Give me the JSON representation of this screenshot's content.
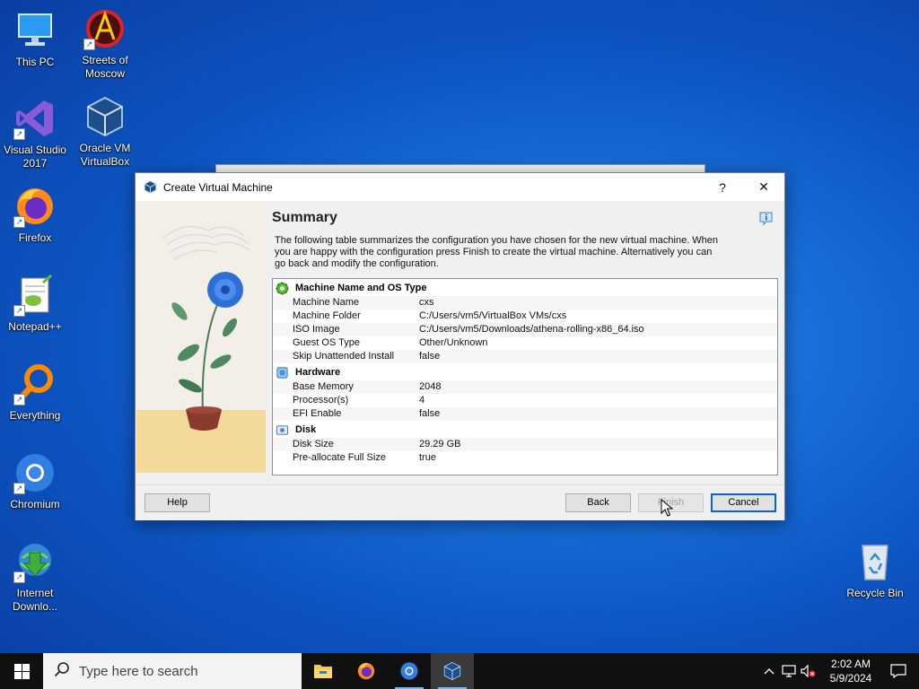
{
  "desktop": {
    "icons": [
      {
        "label": "This PC"
      },
      {
        "label": "Streets of Moscow"
      },
      {
        "label": "Visual Studio 2017"
      },
      {
        "label": "Oracle VM VirtualBox"
      },
      {
        "label": "Firefox"
      },
      {
        "label": "Notepad++"
      },
      {
        "label": "Everything"
      },
      {
        "label": "Chromium"
      },
      {
        "label": "Internet Downlo..."
      },
      {
        "label": "Recycle Bin"
      }
    ]
  },
  "dialog": {
    "title": "Create Virtual Machine",
    "help_glyph": "?",
    "close_glyph": "✕",
    "page_title": "Summary",
    "description": "The following table summarizes the configuration you have chosen for the new virtual machine. When you are happy with the configuration press Finish to create the virtual machine. Alternatively you can go back and modify the configuration.",
    "sections": [
      {
        "title": "Machine Name and OS Type",
        "icon": "gear-icon",
        "rows": [
          {
            "key": "Machine Name",
            "value": "cxs"
          },
          {
            "key": "Machine Folder",
            "value": "C:/Users/vm5/VirtualBox VMs/cxs"
          },
          {
            "key": "ISO Image",
            "value": "C:/Users/vm5/Downloads/athena-rolling-x86_64.iso"
          },
          {
            "key": "Guest OS Type",
            "value": "Other/Unknown"
          },
          {
            "key": "Skip Unattended Install",
            "value": "false"
          }
        ]
      },
      {
        "title": "Hardware",
        "icon": "chip-icon",
        "rows": [
          {
            "key": "Base Memory",
            "value": "2048"
          },
          {
            "key": "Processor(s)",
            "value": "4"
          },
          {
            "key": "EFI Enable",
            "value": "false"
          }
        ]
      },
      {
        "title": "Disk",
        "icon": "disk-icon",
        "rows": [
          {
            "key": "Disk Size",
            "value": "29.29 GB"
          },
          {
            "key": "Pre-allocate Full Size",
            "value": "true"
          }
        ]
      }
    ],
    "buttons": {
      "help": "Help",
      "back": "Back",
      "finish": "Finish",
      "cancel": "Cancel"
    }
  },
  "taskbar": {
    "search_placeholder": "Type here to search",
    "time": "2:02 AM",
    "date": "5/9/2024"
  },
  "colors": {
    "accent": "#0a63c8",
    "desktop": "#1a6fd8"
  }
}
